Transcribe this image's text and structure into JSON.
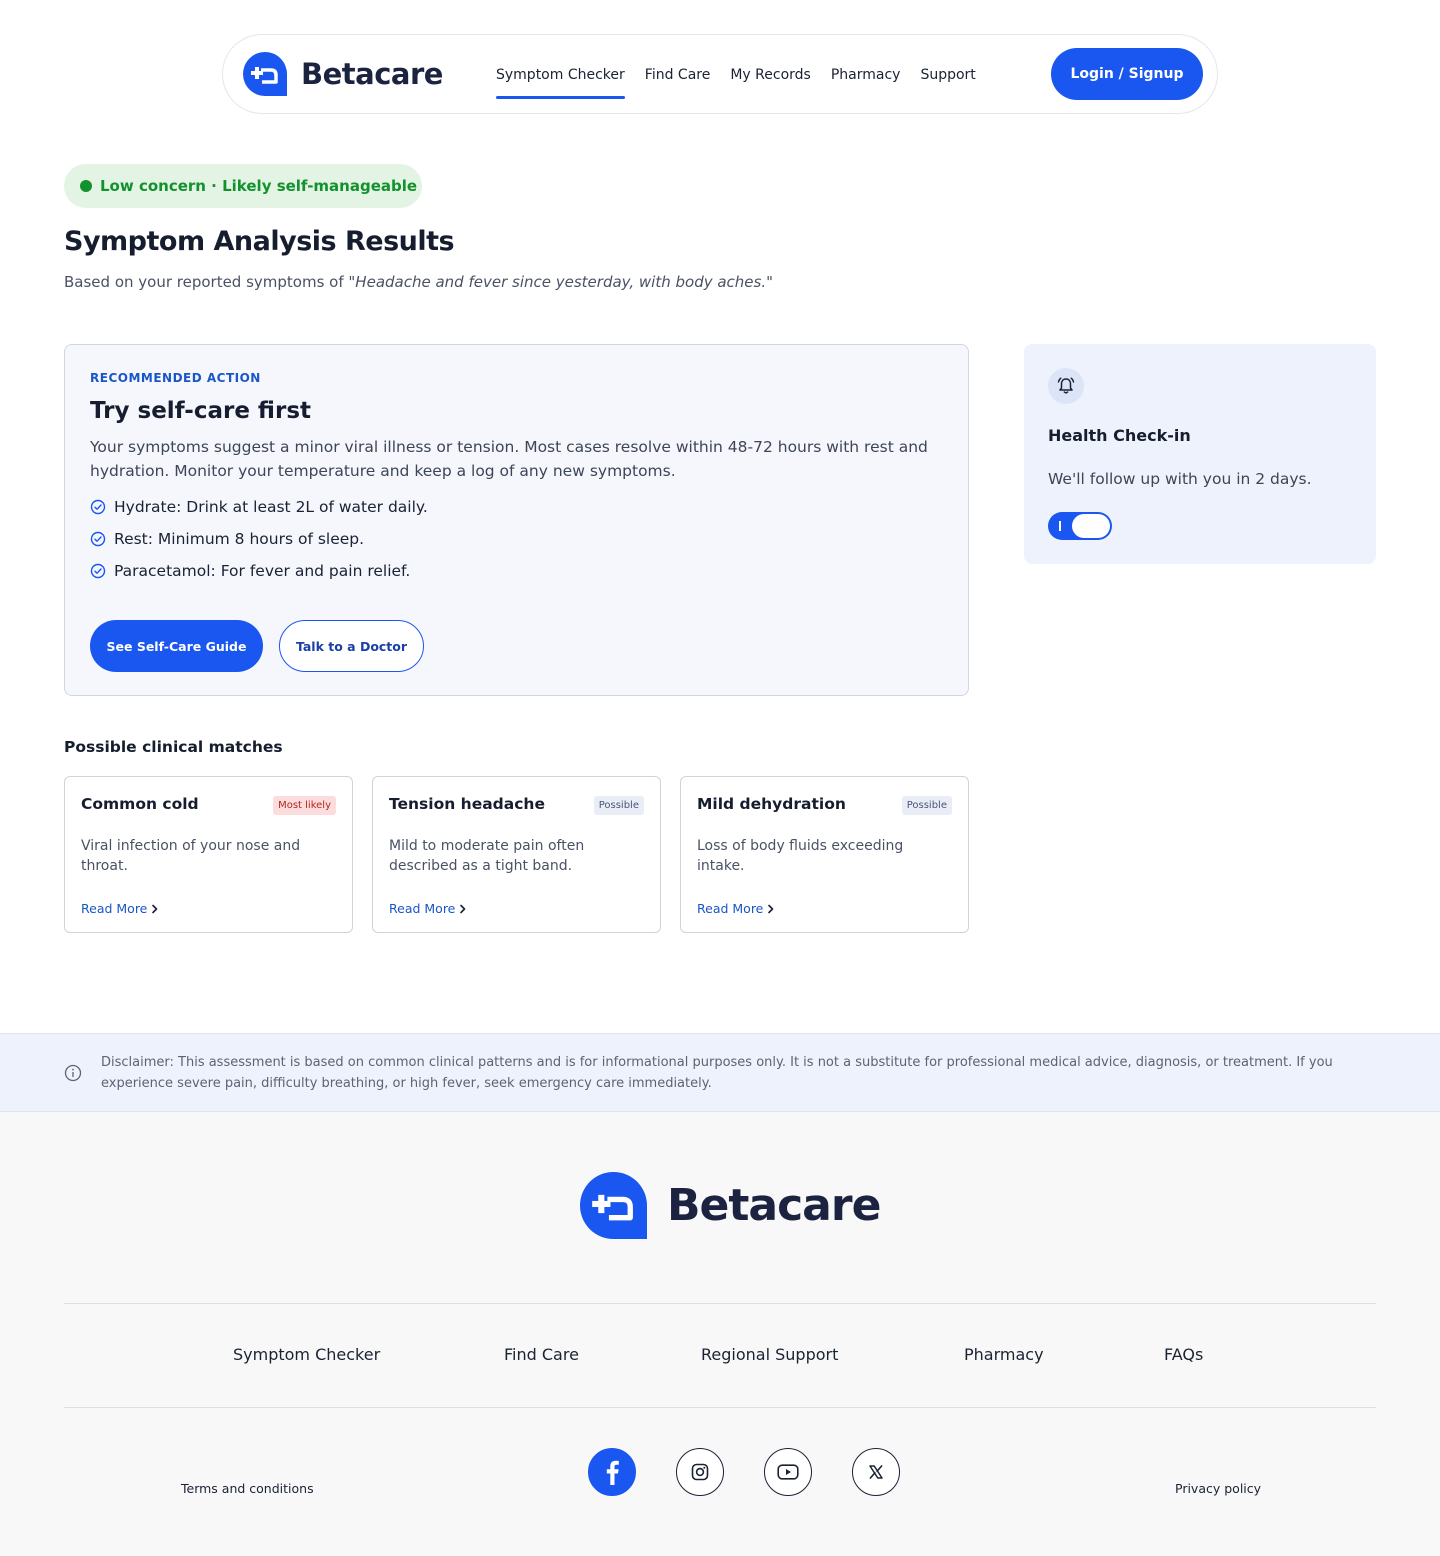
{
  "brand": {
    "name": "Betacare",
    "accent": "#1a56f0"
  },
  "nav": {
    "links": [
      "Symptom Checker",
      "Find Care",
      "My Records",
      "Pharmacy",
      "Support"
    ],
    "active": "Symptom Checker",
    "login_label": "Login / Signup"
  },
  "result": {
    "concern_badge": "Low concern · Likely self-manageable",
    "title": "Symptom Analysis Results",
    "subtitle_prefix": "Based on your reported symptoms of ",
    "subtitle_quote": "\"Headache and fever since yesterday, with body aches.\""
  },
  "recommendation": {
    "eyebrow": "RECOMMENDED ACTION",
    "title": "Try self-care first",
    "description": "Your symptoms suggest a minor viral illness or tension. Most cases resolve within 48-72 hours with rest and hydration. Monitor your temperature and keep a log of any new symptoms.",
    "steps": [
      "Hydrate: Drink at least 2L of water daily.",
      "Rest: Minimum 8 hours of sleep.",
      "Paracetamol: For fever and pain relief."
    ],
    "primary_button": "See Self-Care Guide",
    "secondary_button": "Talk to a Doctor"
  },
  "checkin": {
    "title": "Health Check-in",
    "text": "We'll follow up with you in 2 days.",
    "enabled": true
  },
  "matches": {
    "title": "Possible clinical matches",
    "items": [
      {
        "name": "Common cold",
        "tag": "Most likely",
        "description": "Viral infection of your nose and throat.",
        "link": "Read More"
      },
      {
        "name": "Tension headache",
        "tag": "Possible",
        "description": "Mild to moderate pain often described as a tight band.",
        "link": "Read More"
      },
      {
        "name": "Mild dehydration",
        "tag": "Possible",
        "description": "Loss of body fluids exceeding intake.",
        "link": "Read More"
      }
    ]
  },
  "disclaimer": "Disclaimer: This assessment is based on common clinical patterns and is for informational purposes only. It is not a substitute for professional medical advice, diagnosis, or treatment. If you experience severe pain, difficulty breathing, or high fever, seek emergency care immediately.",
  "footer": {
    "links": [
      "Symptom Checker",
      "Find Care",
      "Regional Support",
      "Pharmacy",
      "FAQs"
    ],
    "social": [
      "facebook-icon",
      "instagram-icon",
      "youtube-icon",
      "x-icon"
    ],
    "terms": "Terms and conditions",
    "privacy": "Privacy policy"
  }
}
